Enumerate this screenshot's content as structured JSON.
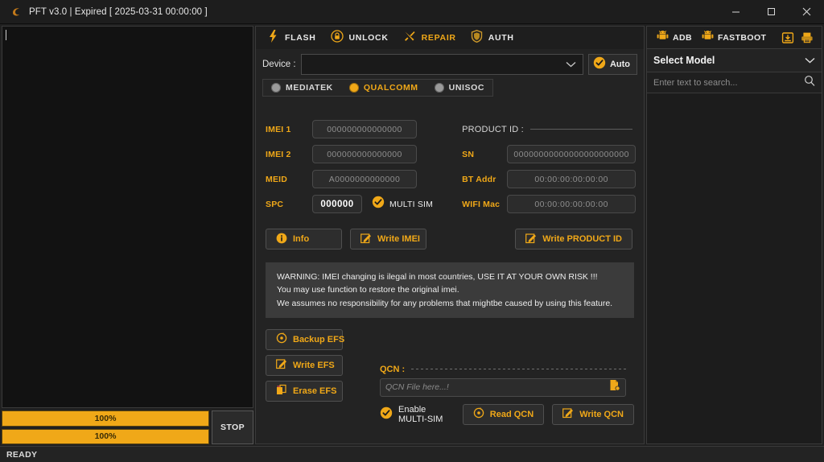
{
  "window": {
    "title": "PFT v3.0  | Expired [ 2025-03-31 00:00:00 ]",
    "minimize_label": "–",
    "maximize_label": "□",
    "close_label": "×"
  },
  "colors": {
    "accent": "#f0a818",
    "panel": "#232323",
    "console": "#121212",
    "warning_bg": "#3b3b3b"
  },
  "tabs": [
    {
      "label": "FLASH",
      "icon": "lightning-icon",
      "active": false
    },
    {
      "label": "UNLOCK",
      "icon": "lock-icon",
      "active": false
    },
    {
      "label": "REPAIR",
      "icon": "tools-icon",
      "active": true
    },
    {
      "label": "AUTH",
      "icon": "shield-icon",
      "active": false
    }
  ],
  "device": {
    "label": "Device :",
    "value": "",
    "auto_label": "Auto"
  },
  "platforms": [
    {
      "label": "MEDIATEK",
      "selected": false
    },
    {
      "label": "QUALCOMM",
      "selected": true
    },
    {
      "label": "UNISOC",
      "selected": false
    }
  ],
  "imei_form": {
    "fields": [
      {
        "label": "IMEI 1",
        "value": "000000000000000"
      },
      {
        "label": "IMEI 2",
        "value": "000000000000000"
      },
      {
        "label": "MEID",
        "value": "A0000000000000"
      }
    ],
    "spc": {
      "label": "SPC",
      "value": "000000"
    },
    "multi_sim": {
      "label": "MULTI SIM",
      "checked": true
    }
  },
  "product_id": {
    "header": "PRODUCT ID :",
    "fields": [
      {
        "label": "SN",
        "value": "00000000000000000000000"
      },
      {
        "label": "BT Addr",
        "value": "00:00:00:00:00:00"
      },
      {
        "label": "WIFI Mac",
        "value": "00:00:00:00:00:00"
      }
    ]
  },
  "actions": {
    "info": "Info",
    "write_imei": "Write IMEI",
    "write_product_id": "Write PRODUCT ID"
  },
  "warning": {
    "line1": "WARNING: IMEI changing is ilegal in most countries, USE IT AT YOUR OWN RISK !!!",
    "line2": "You may use function to restore the original imei.",
    "line3": "We assumes no responsibility for any problems that mightbe caused by using this feature."
  },
  "efs": {
    "backup": "Backup EFS",
    "write": "Write EFS",
    "erase": "Erase EFS"
  },
  "qcn": {
    "label": "QCN :",
    "placeholder": "QCN File here...!",
    "enable_multi_sim": "Enable MULTI-SIM",
    "read": "Read QCN",
    "write": "Write QCN"
  },
  "right_panel": {
    "adb": "ADB",
    "fastboot": "FASTBOOT",
    "select_model": "Select Model",
    "search_placeholder": "Enter text to search..."
  },
  "progress": {
    "bar1": "100%",
    "bar2": "100%",
    "bar1_pct": 100,
    "bar2_pct": 100,
    "stop": "STOP"
  },
  "status": {
    "text": "READY"
  }
}
